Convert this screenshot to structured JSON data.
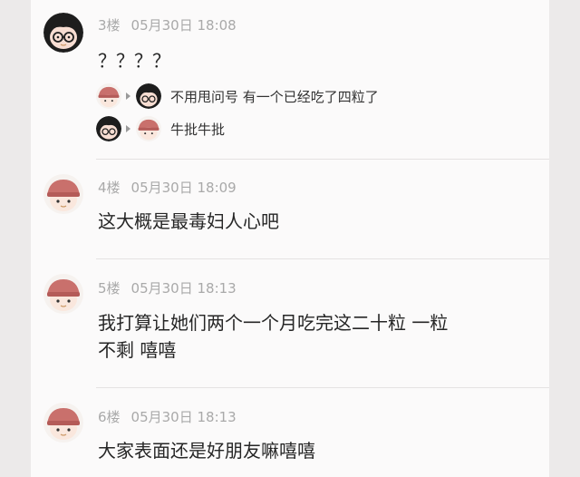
{
  "posts": [
    {
      "floor": "3楼",
      "time": "05月30日 18:08",
      "text": "？？？？",
      "avatar": "boy-with-glasses-avatar",
      "replies": [
        {
          "from_avatar": "girl-with-hat-avatar",
          "to_avatar": "boy-with-glasses-avatar",
          "text": "不用甩问号 有一个已经吃了四粒了"
        },
        {
          "from_avatar": "boy-with-glasses-avatar",
          "to_avatar": "girl-with-hat-avatar",
          "text": "牛批牛批"
        }
      ]
    },
    {
      "floor": "4楼",
      "time": "05月30日 18:09",
      "text": "这大概是最毒妇人心吧",
      "avatar": "girl-with-hat-avatar"
    },
    {
      "floor": "5楼",
      "time": "05月30日 18:13",
      "text_line1": "我打算让她们两个一个月吃完这二十粒 一粒",
      "text_line2": "不剩 嘻嘻",
      "avatar": "girl-with-hat-avatar"
    },
    {
      "floor": "6楼",
      "time": "05月30日 18:13",
      "text": "大家表面还是好朋友嘛嘻嘻",
      "avatar": "girl-with-hat-avatar"
    }
  ],
  "colors": {
    "background": "#eceaea",
    "card": "#fbfafa",
    "meta_text": "#a9a9a9",
    "body_text": "#262626",
    "hat": "#c9706c"
  }
}
